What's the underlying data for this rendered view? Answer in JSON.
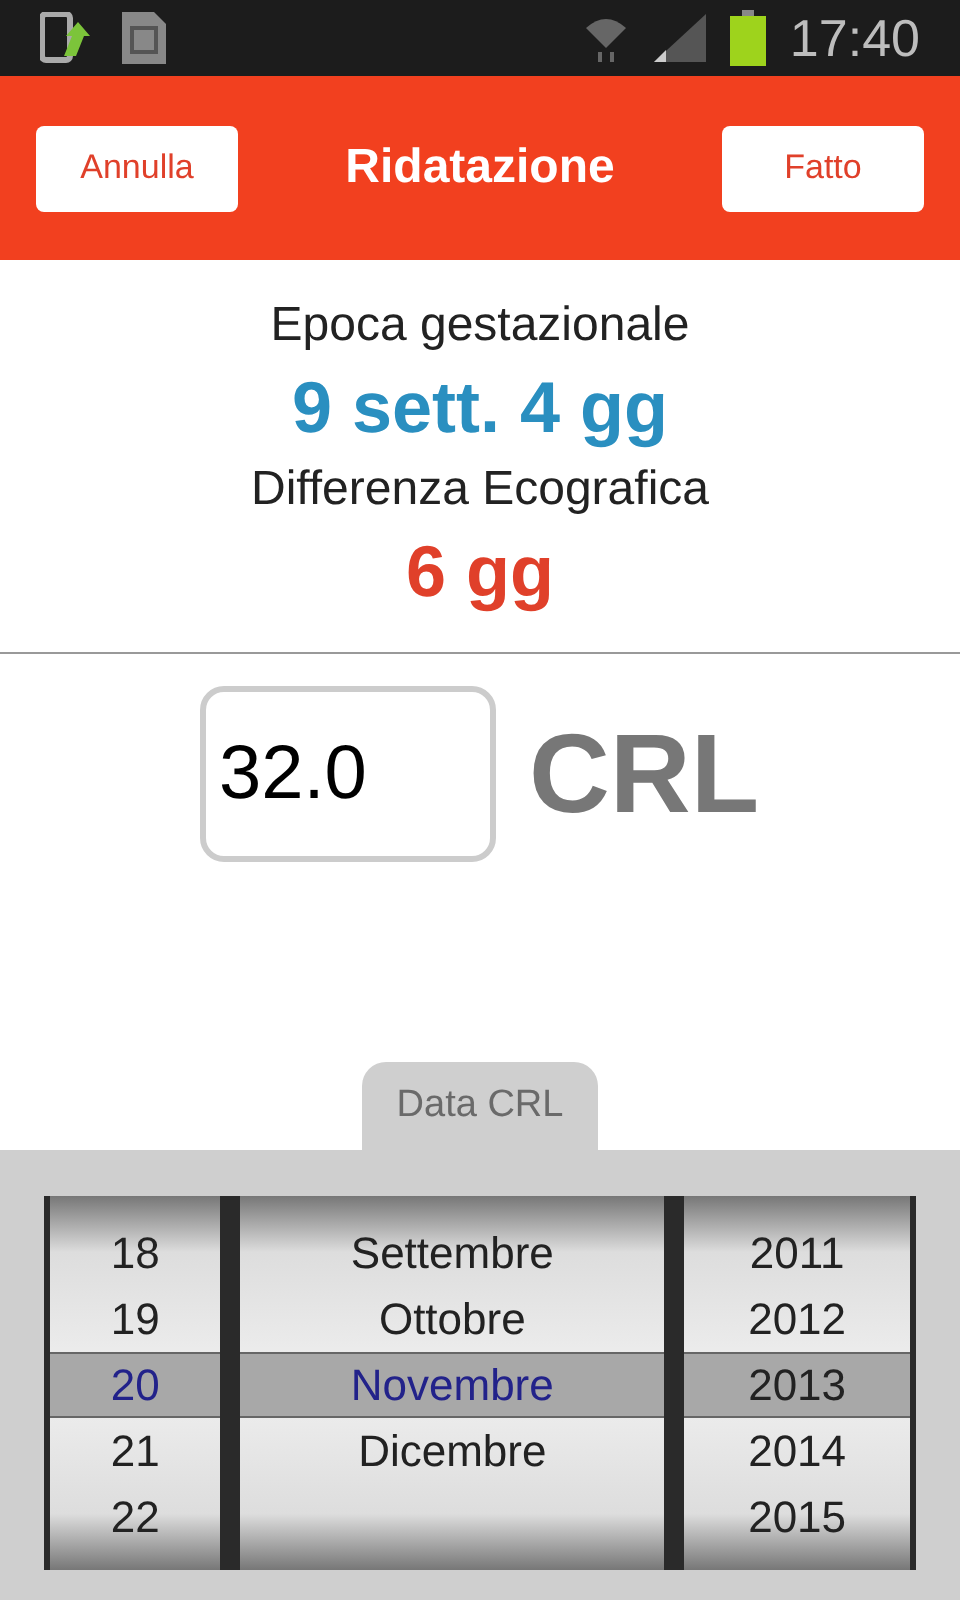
{
  "status_bar": {
    "time": "17:40"
  },
  "header": {
    "cancel": "Annulla",
    "title": "Ridatazione",
    "done": "Fatto"
  },
  "summary": [
    {
      "label": "Epoca gestazionale",
      "value": "9 sett. 4 gg",
      "color": "#2a8fc0"
    },
    {
      "label": "Differenza Ecografica",
      "value": "6 gg",
      "color": "#e0402a"
    }
  ],
  "measure": {
    "value": "32.0",
    "unit": "CRL"
  },
  "picker": {
    "tab": "Data CRL",
    "columns": [
      {
        "kind": "day",
        "items": [
          {
            "label": "18",
            "selected": false
          },
          {
            "label": "19",
            "selected": false
          },
          {
            "label": "20",
            "selected": true
          },
          {
            "label": "21",
            "selected": false
          },
          {
            "label": "22",
            "selected": false
          }
        ]
      },
      {
        "kind": "month",
        "items": [
          {
            "label": "Settembre",
            "selected": false
          },
          {
            "label": "Ottobre",
            "selected": false
          },
          {
            "label": "Novembre",
            "selected": true
          },
          {
            "label": "Dicembre",
            "selected": false
          }
        ]
      },
      {
        "kind": "year",
        "items": [
          {
            "label": "2011",
            "selected": false
          },
          {
            "label": "2012",
            "selected": false
          },
          {
            "label": "2013",
            "selected": true
          },
          {
            "label": "2014",
            "selected": false
          },
          {
            "label": "2015",
            "selected": false
          }
        ]
      }
    ]
  }
}
